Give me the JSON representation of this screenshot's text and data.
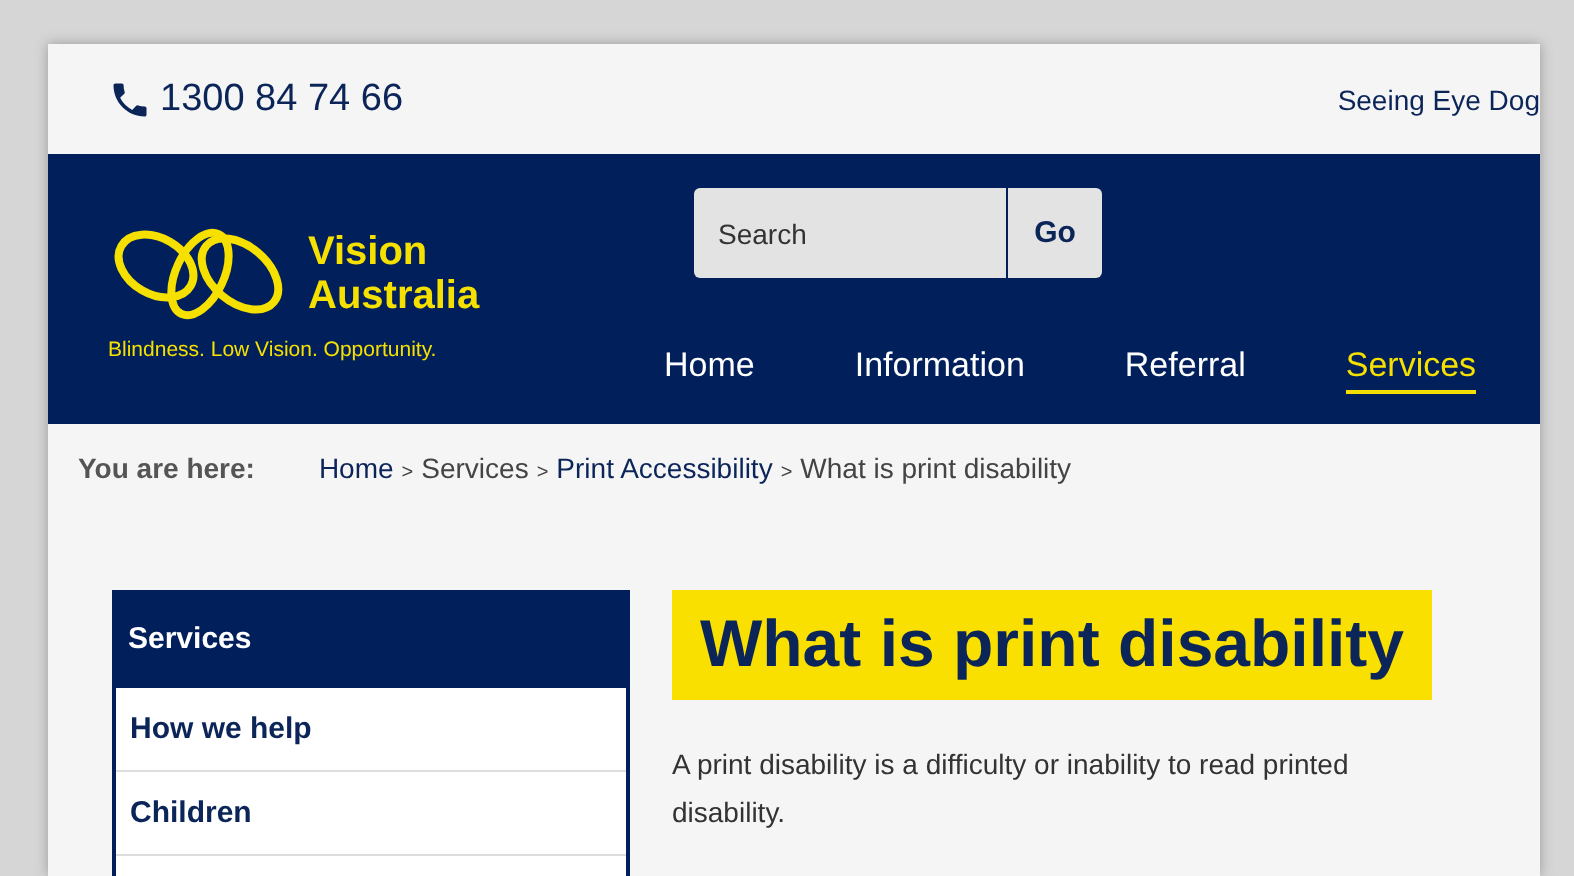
{
  "top_bar": {
    "phone": "1300 84 74 66",
    "link": "Seeing Eye Dog"
  },
  "logo": {
    "line_1": "Vision",
    "line_2": "Australia",
    "tagline": "Blindness. Low Vision. Opportunity."
  },
  "search": {
    "placeholder": "Search",
    "button": "Go"
  },
  "nav": [
    {
      "label": "Home",
      "selected": false
    },
    {
      "label": "Information",
      "selected": false
    },
    {
      "label": "Referral",
      "selected": false
    },
    {
      "label": "Services",
      "selected": true
    }
  ],
  "breadcrumb": {
    "label": "You are here:",
    "items": [
      {
        "text": "Home",
        "link": true
      },
      {
        "text": "Services",
        "link": false
      },
      {
        "text": "Print Accessibility",
        "link": true
      },
      {
        "text": "What is print disability",
        "link": false
      }
    ],
    "separator": ">"
  },
  "sidebar": {
    "title": "Services",
    "items": [
      "How we help",
      "Children"
    ]
  },
  "heading": "What is print disability",
  "paragraph_lines": [
    "A print disability is a difficulty or inability to read printed",
    "disability."
  ]
}
